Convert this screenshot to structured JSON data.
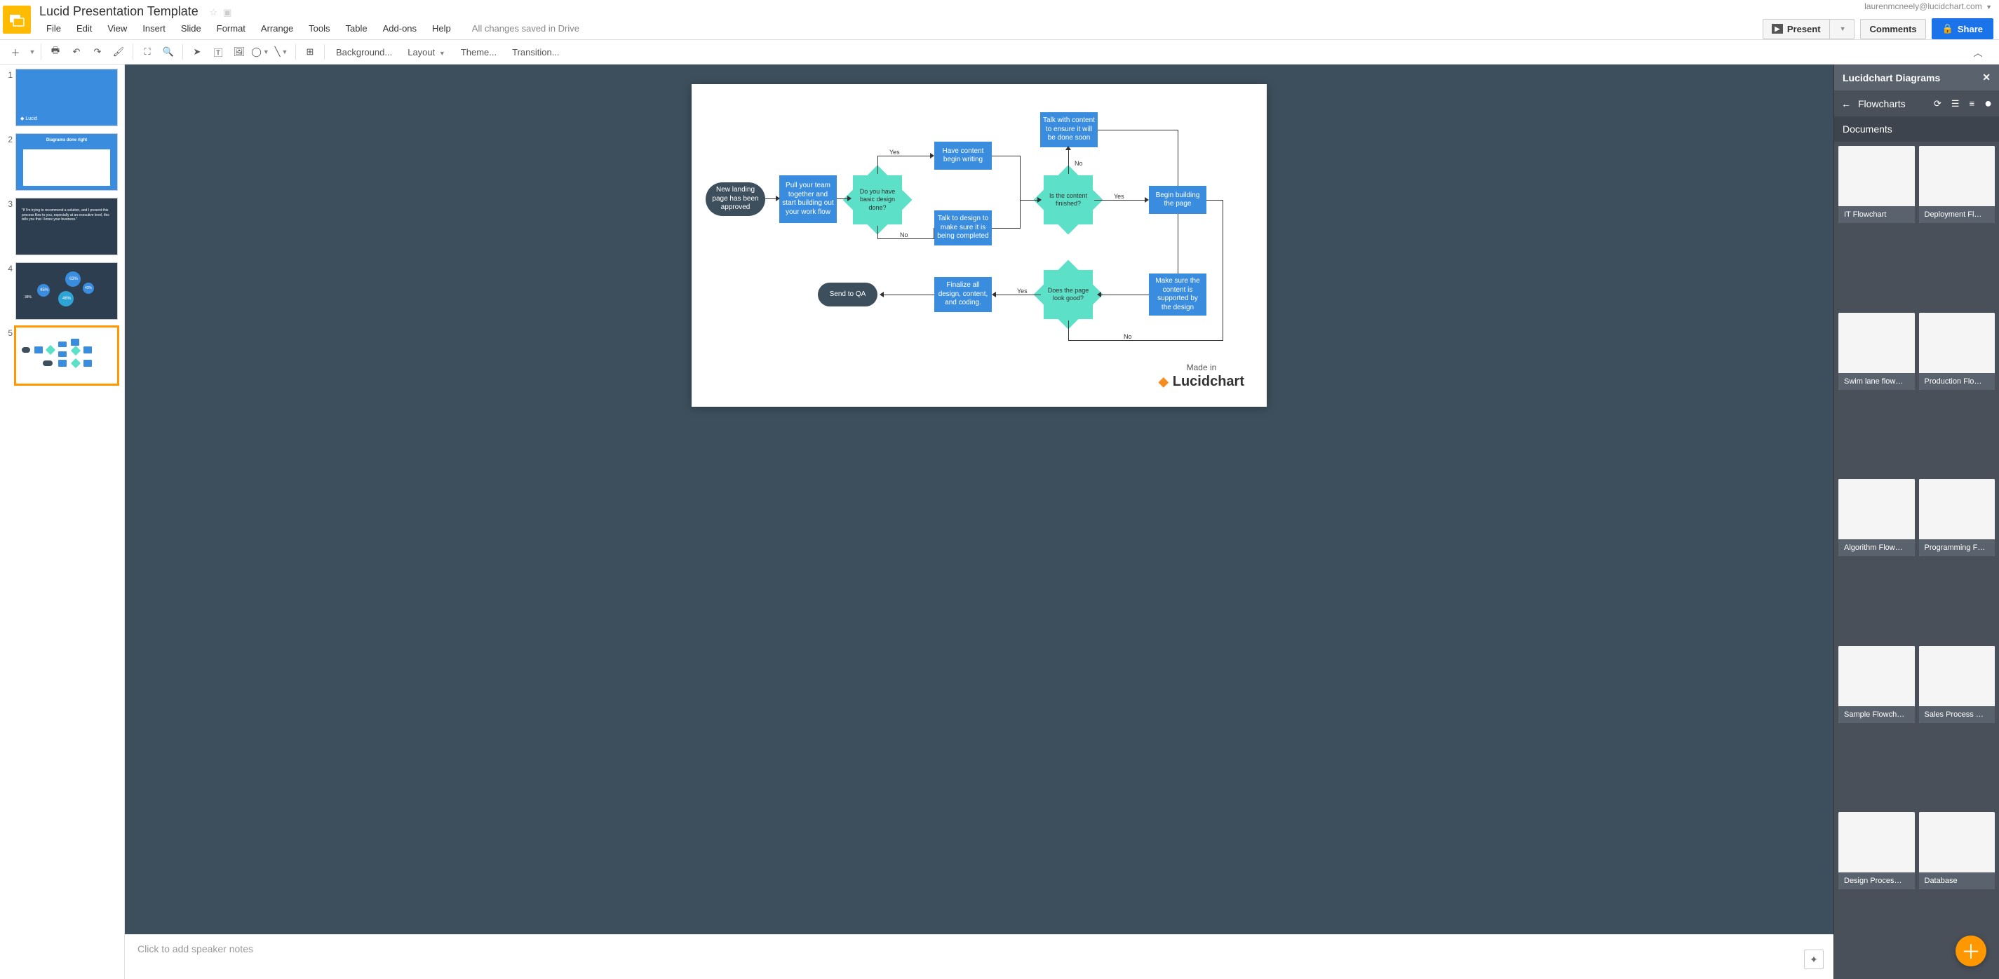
{
  "header": {
    "doc_title": "Lucid Presentation Template",
    "user_email": "laurenmcneely@lucidchart.com",
    "menus": [
      "File",
      "Edit",
      "View",
      "Insert",
      "Slide",
      "Format",
      "Arrange",
      "Tools",
      "Table",
      "Add-ons",
      "Help"
    ],
    "save_status": "All changes saved in Drive",
    "present_label": "Present",
    "comments_label": "Comments",
    "share_label": "Share"
  },
  "toolbar": {
    "background": "Background...",
    "layout": "Layout",
    "theme": "Theme...",
    "transition": "Transition..."
  },
  "flowchart": {
    "start": "New landing page has been approved",
    "pull_team": "Pull your team together and start building out your work flow",
    "design_done": "Do you have basic design done?",
    "begin_writing": "Have content begin writing",
    "talk_design": "Talk to design to make sure it is being completed",
    "talk_content": "Talk with content to ensure it will be done soon",
    "content_finished": "Is the content finished?",
    "build_page": "Begin building the page",
    "content_supported": "Make sure the content is supported by the design",
    "look_good": "Does the page look good?",
    "finalize": "Finalize all design, content, and coding.",
    "send_qa": "Send to QA",
    "yes": "Yes",
    "no": "No",
    "made_in": "Made in",
    "brand": "Lucidchart"
  },
  "notes": {
    "placeholder": "Click to add speaker notes"
  },
  "sidepanel": {
    "title": "Lucidchart Diagrams",
    "breadcrumb": "Flowcharts",
    "section": "Documents",
    "docs": [
      "IT Flowchart",
      "Deployment Fl…",
      "Swim lane flow…",
      "Production Flo…",
      "Algorithm Flow…",
      "Programming F…",
      "Sample Flowch…",
      "Sales Process …",
      "Design Proces…",
      "Database"
    ]
  },
  "filmstrip": {
    "slides": [
      1,
      2,
      3,
      4,
      5
    ]
  }
}
